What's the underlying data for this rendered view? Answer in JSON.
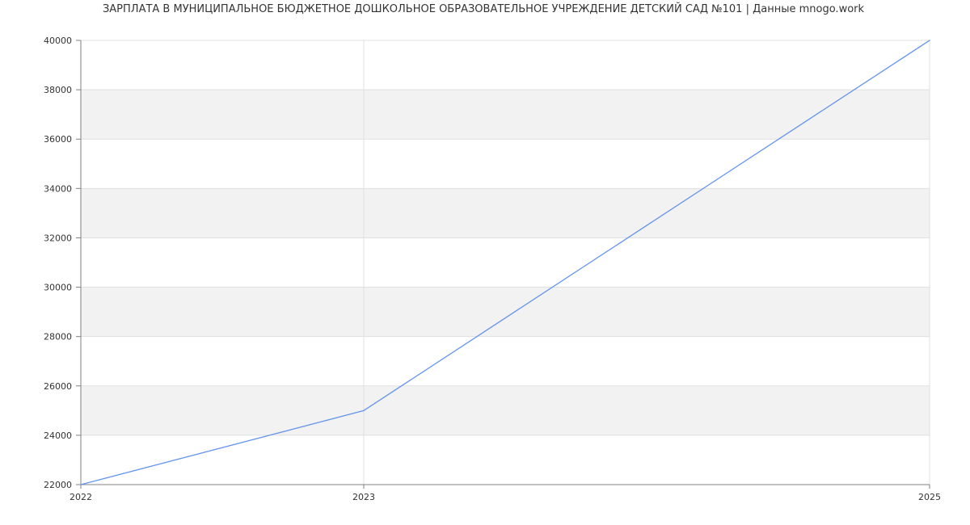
{
  "chart_data": {
    "type": "line",
    "title": "ЗАРПЛАТА В МУНИЦИПАЛЬНОЕ БЮДЖЕТНОЕ ДОШКОЛЬНОЕ ОБРАЗОВАТЕЛЬНОЕ УЧРЕЖДЕНИЕ  ДЕТСКИЙ САД №101 | Данные mnogo.work",
    "xlabel": "",
    "ylabel": "",
    "x_ticks": [
      "2022",
      "2023",
      "2025"
    ],
    "y_ticks": [
      "22000",
      "24000",
      "26000",
      "28000",
      "30000",
      "32000",
      "34000",
      "36000",
      "38000",
      "40000"
    ],
    "ylim": [
      22000,
      40000
    ],
    "grid": true,
    "alternating_bands": true,
    "series": [
      {
        "values": [
          22000,
          25000,
          40000
        ]
      }
    ],
    "colors": {
      "line": "#6495ed",
      "band": "#f2f2f2",
      "grid": "#e0e0e0",
      "axis": "#808080",
      "text": "#333333"
    }
  }
}
